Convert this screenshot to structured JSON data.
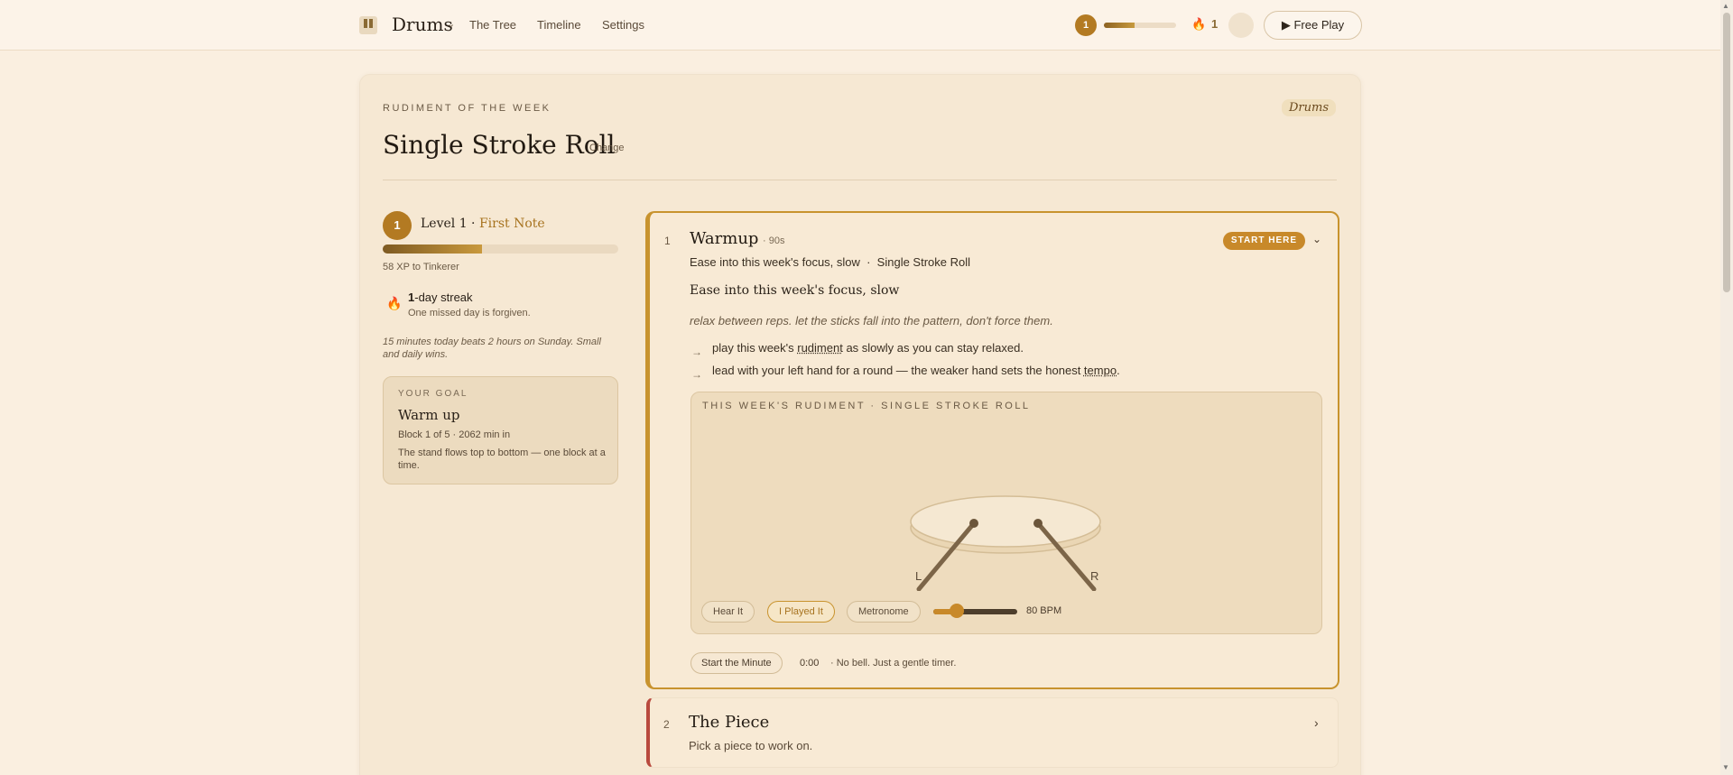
{
  "header": {
    "brand": "Drums",
    "nav": [
      "The Tree",
      "Timeline",
      "Settings"
    ],
    "level": "1",
    "xp_progress": 0.42,
    "streak": "1",
    "free_play": "Free Play"
  },
  "page": {
    "eyebrow": "RUDIMENT OF THE WEEK",
    "tag": "Drums",
    "title": "Single Stroke Roll",
    "change": "Change"
  },
  "sidebar": {
    "level_num": "1",
    "level_label": "Level 1 · ",
    "level_name": "First Note",
    "xp_progress": 0.42,
    "xp_text": "58 XP to Tinkerer",
    "streak_num": "1",
    "streak_rest": "-day streak",
    "streak_sub": "One missed day is forgiven.",
    "quote": "15 minutes today beats 2 hours on Sunday. Small and daily wins.",
    "goal": {
      "eyebrow": "YOUR GOAL",
      "title": "Warm up",
      "meta": "Block 1 of 5 · 2062 min in",
      "desc": "The stand flows top to bottom — one block at a time."
    }
  },
  "warmup": {
    "num": "1",
    "title": "Warmup",
    "duration": "· 90s",
    "badge": "START HERE",
    "subtitle": "Ease into this week's focus, slow  ·  Single Stroke Roll",
    "focus": "Ease into this week's focus, slow",
    "tip": "relax between reps. let the sticks fall into the pattern, don't force them.",
    "bullet1": {
      "pre": "play this week's ",
      "term": "rudiment",
      "post": " as slowly as you can stay relaxed."
    },
    "bullet2": {
      "pre": "lead with your left hand for a round — the weaker hand sets the honest ",
      "term": "tempo",
      "post": "."
    },
    "panel": {
      "eyebrow": "THIS WEEK'S RUDIMENT · SINGLE STROKE ROLL",
      "left": "L",
      "right": "R",
      "hear": "Hear It",
      "played": "I Played It",
      "metronome": "Metronome",
      "bpm": "80 BPM",
      "bpm_value": 80
    },
    "start_minute": "Start the Minute",
    "timer": "0:00",
    "timer_note": "· No bell. Just a gentle timer."
  },
  "piece": {
    "num": "2",
    "title": "The Piece",
    "subtitle": "Pick a piece to work on."
  },
  "colors": {
    "accent": "#c8892a",
    "background": "#faefe0",
    "piece_accent": "#b94a3e"
  }
}
